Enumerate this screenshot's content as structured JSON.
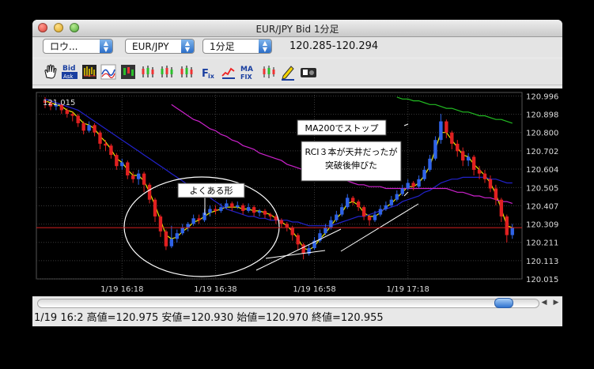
{
  "window": {
    "title": "EUR/JPY Bid 1分足"
  },
  "toolbar": {
    "selects": [
      {
        "value": "ロウ..."
      },
      {
        "value": "EUR/JPY"
      },
      {
        "value": "1分足"
      }
    ],
    "price_range": "120.285-120.294",
    "buttons": [
      "hand-icon",
      "bid-ask-icon",
      "bars-icon",
      "line-icon",
      "candles-icon",
      "candles-2-icon",
      "candles-3-icon",
      "candles-4-icon",
      "fix-icon",
      "chart-line-icon",
      "ma-fix-icon",
      "sub-chart-icon",
      "pen-icon",
      "camera-icon"
    ]
  },
  "chart_data": {
    "type": "candlestick",
    "corner_label": "121.015",
    "y_ticks": [
      "120.996",
      "120.898",
      "120.800",
      "120.702",
      "120.604",
      "120.505",
      "120.407",
      "120.309",
      "120.211",
      "120.113",
      "120.015"
    ],
    "x_ticks": [
      "1/19 16:18",
      "1/19 16:38",
      "1/19 16:58",
      "1/19 17:18"
    ],
    "ylim": [
      120.015,
      121.015
    ],
    "current_price": 120.29,
    "candles": [
      [
        120.97,
        120.96,
        120.99,
        120.93
      ],
      [
        120.96,
        120.94,
        120.97,
        120.92
      ],
      [
        120.94,
        120.95,
        120.96,
        120.92
      ],
      [
        120.95,
        120.92,
        120.96,
        120.9
      ],
      [
        120.92,
        120.9,
        120.93,
        120.88
      ],
      [
        120.9,
        120.89,
        120.91,
        120.86
      ],
      [
        120.89,
        120.85,
        120.9,
        120.83
      ],
      [
        120.85,
        120.81,
        120.86,
        120.79
      ],
      [
        120.81,
        120.84,
        120.86,
        120.8
      ],
      [
        120.84,
        120.8,
        120.85,
        120.78
      ],
      [
        120.8,
        120.74,
        120.81,
        120.71
      ],
      [
        120.74,
        120.73,
        120.76,
        120.7
      ],
      [
        120.73,
        120.68,
        120.74,
        120.66
      ],
      [
        120.68,
        120.62,
        120.69,
        120.6
      ],
      [
        120.62,
        120.64,
        120.66,
        120.6
      ],
      [
        120.64,
        120.57,
        120.65,
        120.55
      ],
      [
        120.57,
        120.55,
        120.59,
        120.53
      ],
      [
        120.55,
        120.58,
        120.6,
        120.52
      ],
      [
        120.58,
        120.52,
        120.59,
        120.48
      ],
      [
        120.52,
        120.44,
        120.53,
        120.42
      ],
      [
        120.44,
        120.35,
        120.45,
        120.32
      ],
      [
        120.35,
        120.27,
        120.36,
        120.24
      ],
      [
        120.27,
        120.19,
        120.28,
        120.17
      ],
      [
        120.19,
        120.23,
        120.3,
        120.18
      ],
      [
        120.23,
        120.26,
        120.28,
        120.21
      ],
      [
        120.26,
        120.29,
        120.31,
        120.25
      ],
      [
        120.29,
        120.31,
        120.32,
        120.27
      ],
      [
        120.31,
        120.34,
        120.36,
        120.3
      ],
      [
        120.34,
        120.33,
        120.36,
        120.31
      ],
      [
        120.33,
        120.37,
        120.39,
        120.32
      ],
      [
        120.37,
        120.39,
        120.41,
        120.35
      ],
      [
        120.39,
        120.38,
        120.41,
        120.36
      ],
      [
        120.38,
        120.4,
        120.42,
        120.37
      ],
      [
        120.4,
        120.42,
        120.44,
        120.39
      ],
      [
        120.42,
        120.4,
        120.43,
        120.38
      ],
      [
        120.4,
        120.41,
        120.43,
        120.39
      ],
      [
        120.41,
        120.38,
        120.42,
        120.36
      ],
      [
        120.38,
        120.4,
        120.42,
        120.37
      ],
      [
        120.4,
        120.37,
        120.41,
        120.35
      ],
      [
        120.37,
        120.38,
        120.39,
        120.35
      ],
      [
        120.38,
        120.36,
        120.39,
        120.34
      ],
      [
        120.36,
        120.35,
        120.37,
        120.33
      ],
      [
        120.35,
        120.33,
        120.36,
        120.31
      ],
      [
        120.33,
        120.31,
        120.34,
        120.29
      ],
      [
        120.31,
        120.29,
        120.32,
        120.27
      ],
      [
        120.29,
        120.25,
        120.3,
        120.22
      ],
      [
        120.25,
        120.2,
        120.26,
        120.17
      ],
      [
        120.2,
        120.15,
        120.21,
        120.12
      ],
      [
        120.15,
        120.18,
        120.2,
        120.14
      ],
      [
        120.18,
        120.22,
        120.24,
        120.17
      ],
      [
        120.22,
        120.26,
        120.28,
        120.21
      ],
      [
        120.26,
        120.29,
        120.31,
        120.25
      ],
      [
        120.29,
        120.33,
        120.35,
        120.28
      ],
      [
        120.33,
        120.36,
        120.38,
        120.32
      ],
      [
        120.36,
        120.4,
        120.42,
        120.35
      ],
      [
        120.4,
        120.45,
        120.47,
        120.39
      ],
      [
        120.45,
        120.43,
        120.46,
        120.41
      ],
      [
        120.43,
        120.4,
        120.44,
        120.38
      ],
      [
        120.4,
        120.35,
        120.41,
        120.33
      ],
      [
        120.35,
        120.33,
        120.36,
        120.3
      ],
      [
        120.33,
        120.36,
        120.38,
        120.32
      ],
      [
        120.36,
        120.39,
        120.41,
        120.35
      ],
      [
        120.39,
        120.41,
        120.43,
        120.38
      ],
      [
        120.41,
        120.44,
        120.46,
        120.4
      ],
      [
        120.44,
        120.47,
        120.49,
        120.43
      ],
      [
        120.47,
        120.5,
        120.52,
        120.46
      ],
      [
        120.5,
        120.53,
        120.55,
        120.49
      ],
      [
        120.53,
        120.51,
        120.54,
        120.49
      ],
      [
        120.51,
        120.55,
        120.57,
        120.5
      ],
      [
        120.55,
        120.6,
        120.62,
        120.54
      ],
      [
        120.6,
        120.66,
        120.68,
        120.59
      ],
      [
        120.66,
        120.76,
        120.78,
        120.65
      ],
      [
        120.76,
        120.86,
        120.9,
        120.74
      ],
      [
        120.86,
        120.8,
        120.87,
        120.77
      ],
      [
        120.8,
        120.74,
        120.81,
        120.71
      ],
      [
        120.74,
        120.7,
        120.76,
        120.67
      ],
      [
        120.7,
        120.65,
        120.72,
        120.62
      ],
      [
        120.65,
        120.67,
        120.69,
        120.62
      ],
      [
        120.67,
        120.6,
        120.68,
        120.57
      ],
      [
        120.6,
        120.58,
        120.62,
        120.55
      ],
      [
        120.58,
        120.55,
        120.6,
        120.53
      ],
      [
        120.55,
        120.5,
        120.57,
        120.48
      ],
      [
        120.5,
        120.44,
        120.52,
        120.41
      ],
      [
        120.44,
        120.35,
        120.45,
        120.32
      ],
      [
        120.35,
        120.25,
        120.36,
        120.21
      ],
      [
        120.25,
        120.29,
        120.31,
        120.23
      ]
    ],
    "series": [
      {
        "color": "#e8e800",
        "values": [
          120.97,
          120.96,
          120.95,
          120.94,
          120.92,
          120.91,
          120.88,
          120.85,
          120.84,
          120.82,
          120.78,
          120.75,
          120.71,
          120.66,
          120.64,
          120.6,
          120.57,
          120.57,
          120.54,
          120.48,
          120.41,
          120.33,
          120.25,
          120.23,
          120.24,
          120.27,
          120.29,
          120.32,
          120.33,
          120.35,
          120.37,
          120.38,
          120.39,
          120.4,
          120.4,
          120.4,
          120.39,
          120.39,
          120.38,
          120.38,
          120.37,
          120.36,
          120.34,
          120.32,
          120.3,
          120.27,
          120.23,
          120.18,
          120.17,
          120.19,
          120.23,
          120.26,
          120.3,
          120.34,
          120.37,
          120.42,
          120.43,
          120.41,
          120.37,
          120.35,
          120.35,
          120.37,
          120.4,
          120.42,
          120.45,
          120.48,
          120.51,
          120.51,
          120.53,
          120.57,
          120.62,
          120.71,
          120.8,
          120.8,
          120.76,
          120.72,
          120.68,
          120.67,
          120.63,
          120.6,
          120.57,
          120.53,
          120.47,
          120.39,
          120.3,
          120.29
        ]
      },
      {
        "color": "#2222cc",
        "values": [
          120.98,
          120.97,
          120.96,
          120.95,
          120.94,
          120.93,
          120.92,
          120.9,
          120.88,
          120.86,
          120.84,
          120.82,
          120.8,
          120.78,
          120.76,
          120.74,
          120.72,
          120.7,
          120.68,
          120.66,
          120.64,
          120.62,
          120.6,
          120.58,
          120.56,
          120.54,
          120.52,
          120.5,
          120.48,
          120.47,
          120.45,
          120.43,
          120.41,
          120.39,
          120.38,
          120.37,
          120.36,
          120.35,
          120.35,
          120.34,
          120.34,
          120.33,
          120.33,
          120.33,
          120.33,
          120.32,
          120.32,
          120.31,
          120.3,
          120.3,
          120.3,
          120.3,
          120.3,
          120.31,
          120.32,
          120.33,
          120.34,
          120.35,
          120.35,
          120.36,
          120.37,
          120.38,
          120.39,
          120.4,
          120.41,
          120.43,
          120.44,
          120.45,
          120.46,
          120.48,
          120.49,
          120.51,
          120.53,
          120.54,
          120.55,
          120.55,
          120.56,
          120.56,
          120.56,
          120.56,
          120.56,
          120.55,
          120.55,
          120.54,
          120.53,
          120.53
        ]
      },
      {
        "color": "#cc22cc",
        "values": [
          null,
          null,
          null,
          null,
          null,
          null,
          null,
          null,
          null,
          null,
          null,
          null,
          null,
          null,
          null,
          null,
          null,
          null,
          null,
          null,
          null,
          null,
          null,
          120.95,
          120.93,
          120.91,
          120.89,
          120.87,
          120.86,
          120.84,
          120.82,
          120.81,
          120.79,
          120.78,
          120.76,
          120.75,
          120.73,
          120.72,
          120.71,
          120.69,
          120.68,
          120.67,
          120.66,
          120.65,
          120.63,
          120.62,
          120.61,
          120.6,
          120.59,
          120.58,
          120.58,
          120.57,
          120.56,
          120.55,
          120.55,
          120.54,
          120.53,
          120.52,
          120.52,
          120.51,
          120.51,
          120.51,
          120.5,
          120.5,
          120.5,
          120.5,
          120.5,
          120.5,
          120.5,
          120.5,
          120.5,
          120.5,
          120.5,
          120.5,
          120.49,
          120.48,
          120.48,
          120.47,
          120.46,
          120.46,
          120.45,
          120.45,
          120.44,
          120.43,
          120.43,
          120.42
        ]
      },
      {
        "color": "#22bb22",
        "values": [
          null,
          null,
          null,
          null,
          null,
          null,
          null,
          null,
          null,
          null,
          null,
          null,
          null,
          null,
          null,
          null,
          null,
          null,
          null,
          null,
          null,
          null,
          null,
          null,
          null,
          null,
          null,
          null,
          null,
          null,
          null,
          null,
          null,
          null,
          null,
          null,
          null,
          null,
          null,
          null,
          null,
          null,
          null,
          null,
          null,
          null,
          null,
          null,
          null,
          null,
          null,
          null,
          null,
          null,
          null,
          null,
          null,
          null,
          null,
          null,
          null,
          null,
          null,
          null,
          120.99,
          120.98,
          120.98,
          120.97,
          120.97,
          120.96,
          120.95,
          120.95,
          120.94,
          120.93,
          120.93,
          120.92,
          120.91,
          120.91,
          120.9,
          120.89,
          120.89,
          120.88,
          120.87,
          120.87,
          120.86,
          120.85
        ]
      }
    ],
    "annotations": [
      {
        "text": "よくある形"
      },
      {
        "text": "MA200でストップ"
      },
      {
        "text": "RCI３本が天井だったが\n突破後伸びた"
      }
    ]
  },
  "status": {
    "text": "1/19 16:2 高値=120.975 安値=120.930 始値=120.970 終値=120.955"
  }
}
